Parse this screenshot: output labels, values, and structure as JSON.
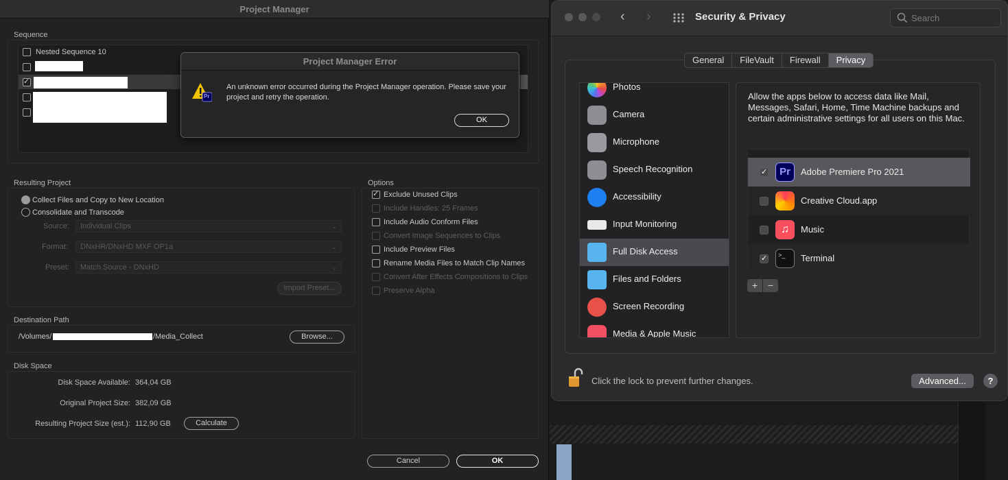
{
  "project_manager": {
    "title": "Project Manager",
    "sequence": {
      "label": "Sequence",
      "items": [
        {
          "label": "Nested Sequence 10",
          "checked": false
        },
        {
          "label": "",
          "checked": false
        },
        {
          "label": "",
          "checked": true
        },
        {
          "label": "",
          "checked": false
        },
        {
          "label": "",
          "checked": false
        }
      ]
    },
    "resulting_project": {
      "label": "Resulting Project",
      "option_collect": "Collect Files and Copy to New Location",
      "option_consolidate": "Consolidate and Transcode",
      "source_label": "Source:",
      "source_value": "Individual Clips",
      "format_label": "Format:",
      "format_value": "DNxHR/DNxHD MXF OP1a",
      "preset_label": "Preset:",
      "preset_value": "Match Source - DNxHD",
      "import_preset": "Import Preset..."
    },
    "options": {
      "label": "Options",
      "items": [
        {
          "label": "Exclude Unused Clips",
          "checked": true,
          "enabled": true
        },
        {
          "label": "Include Handles:  25 Frames",
          "checked": false,
          "enabled": false
        },
        {
          "label": "Include Audio Conform Files",
          "checked": false,
          "enabled": true
        },
        {
          "label": "Convert Image Sequences to Clips",
          "checked": false,
          "enabled": false
        },
        {
          "label": "Include Preview Files",
          "checked": false,
          "enabled": true
        },
        {
          "label": "Rename Media Files to Match Clip Names",
          "checked": false,
          "enabled": true
        },
        {
          "label": "Convert After Effects Compositions to Clips",
          "checked": false,
          "enabled": false
        },
        {
          "label": "Preserve Alpha",
          "checked": false,
          "enabled": false
        }
      ]
    },
    "destination": {
      "label": "Destination Path",
      "prefix": "/Volumes/",
      "suffix": "/Media_Collect",
      "browse": "Browse..."
    },
    "disk_space": {
      "label": "Disk Space",
      "available_label": "Disk Space Available:",
      "available_value": "364,04 GB",
      "original_label": "Original Project Size:",
      "original_value": "382,09 GB",
      "resulting_label": "Resulting Project Size (est.):",
      "resulting_value": "112,90 GB",
      "calculate": "Calculate"
    },
    "cancel": "Cancel",
    "ok": "OK",
    "error": {
      "title": "Project Manager Error",
      "message": "An unknown error occurred during the Project Manager operation. Please save your project and retry the operation.",
      "ok": "OK",
      "icon_badge": "Pr"
    }
  },
  "security_privacy": {
    "title": "Security & Privacy",
    "search_placeholder": "Search",
    "tabs": [
      "General",
      "FileVault",
      "Firewall",
      "Privacy"
    ],
    "active_tab": "Privacy",
    "categories": [
      {
        "label": "Photos",
        "icon": "photos-icon"
      },
      {
        "label": "Camera",
        "icon": "camera-icon"
      },
      {
        "label": "Microphone",
        "icon": "microphone-icon"
      },
      {
        "label": "Speech Recognition",
        "icon": "waveform-icon"
      },
      {
        "label": "Accessibility",
        "icon": "accessibility-icon"
      },
      {
        "label": "Input Monitoring",
        "icon": "keyboard-icon"
      },
      {
        "label": "Full Disk Access",
        "icon": "folder-icon"
      },
      {
        "label": "Files and Folders",
        "icon": "folder-icon"
      },
      {
        "label": "Screen Recording",
        "icon": "screen-record-icon"
      },
      {
        "label": "Media & Apple Music",
        "icon": "music-icon"
      }
    ],
    "selected_category": "Full Disk Access",
    "description": "Allow the apps below to access data like Mail, Messages, Safari, Home, Time Machine backups and certain administrative settings for all users on this Mac.",
    "apps": [
      {
        "label": "Adobe Premiere Pro 2021",
        "checked": true,
        "icon_text": "Pr"
      },
      {
        "label": "Creative Cloud.app",
        "checked": false,
        "icon_text": ""
      },
      {
        "label": "Music",
        "checked": false,
        "icon_text": "♫"
      },
      {
        "label": "Terminal",
        "checked": true,
        "icon_text": ">_"
      }
    ],
    "add": "+",
    "remove": "−",
    "lock_text": "Click the lock to prevent further changes.",
    "advanced": "Advanced...",
    "help": "?"
  }
}
